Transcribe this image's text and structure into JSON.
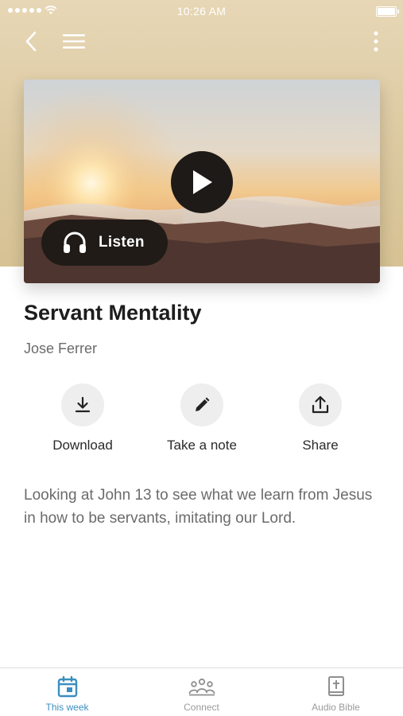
{
  "status_bar": {
    "time": "10:26 AM"
  },
  "nav": {
    "back_icon": "chevron-left-icon",
    "menu_icon": "hamburger-menu-icon",
    "more_icon": "more-vertical-icon"
  },
  "hero": {
    "image": "sunrise-over-clouds",
    "play_icon": "play-icon",
    "listen_label": "Listen"
  },
  "sermon": {
    "title": "Servant Mentality",
    "author": "Jose Ferrer",
    "description": "Looking at John 13 to see what we learn from Jesus in how to be servants, imitating our Lord."
  },
  "actions": [
    {
      "label": "Download",
      "icon": "download-icon"
    },
    {
      "label": "Take a note",
      "icon": "pencil-icon"
    },
    {
      "label": "Share",
      "icon": "share-icon"
    }
  ],
  "tabs": [
    {
      "label": "This week",
      "icon": "calendar-icon",
      "active": true
    },
    {
      "label": "Connect",
      "icon": "people-icon",
      "active": false
    },
    {
      "label": "Audio Bible",
      "icon": "bible-icon",
      "active": false
    }
  ],
  "colors": {
    "header_bg": "#dcc9a1",
    "accent": "#3a8fbf",
    "button_dark": "#1e1a17",
    "action_circle": "#eeeeee"
  }
}
